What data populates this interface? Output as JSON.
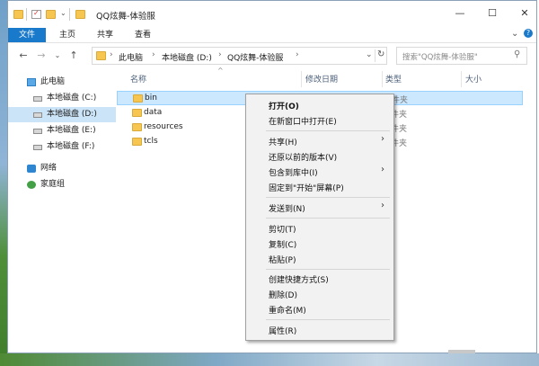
{
  "window": {
    "title": "QQ炫舞-体验服",
    "controls": {
      "minimize": "—",
      "maximize": "☐",
      "close": "✕"
    }
  },
  "ribbon": {
    "tabs": [
      "文件",
      "主页",
      "共享",
      "查看"
    ],
    "expand": "⌄",
    "help": "?"
  },
  "address": {
    "back": "←",
    "forward": "→",
    "recent": "⌄",
    "up": "↑",
    "crumbs": [
      "此电脑",
      "本地磁盘 (D:)",
      "QQ炫舞-体验服"
    ],
    "separator": "›",
    "dropdown": "⌄",
    "refresh": "↻",
    "search_placeholder": "搜索\"QQ炫舞-体验服\"",
    "search_icon": "⚲"
  },
  "navpane": {
    "items": [
      {
        "label": "此电脑",
        "icon": "computer-icon"
      },
      {
        "label": "本地磁盘 (C:)",
        "icon": "drive-icon"
      },
      {
        "label": "本地磁盘 (D:)",
        "icon": "drive-icon",
        "selected": true
      },
      {
        "label": "本地磁盘 (E:)",
        "icon": "drive-icon"
      },
      {
        "label": "本地磁盘 (F:)",
        "icon": "drive-icon"
      },
      {
        "label": "网络",
        "icon": "network-icon"
      },
      {
        "label": "家庭组",
        "icon": "homegroup-icon"
      }
    ]
  },
  "filelist": {
    "columns": [
      "名称",
      "修改日期",
      "类型",
      "大小"
    ],
    "sort_indicator": "^",
    "rows": [
      {
        "name": "bin",
        "type": "件夹",
        "selected": true
      },
      {
        "name": "data",
        "type": "件夹"
      },
      {
        "name": "resources",
        "type": "件夹"
      },
      {
        "name": "tcls",
        "type": "件夹"
      }
    ]
  },
  "context_menu": {
    "arrow": "›",
    "items": [
      {
        "label": "打开(O)",
        "bold": true
      },
      {
        "label": "在新窗口中打开(E)"
      },
      {
        "label": "共享(H)",
        "submenu": true
      },
      {
        "label": "还原以前的版本(V)"
      },
      {
        "label": "包含到库中(I)",
        "submenu": true
      },
      {
        "label": "固定到\"开始\"屏幕(P)"
      },
      {
        "label": "发送到(N)",
        "submenu": true
      },
      {
        "label": "剪切(T)"
      },
      {
        "label": "复制(C)"
      },
      {
        "label": "粘贴(P)"
      },
      {
        "label": "创建快捷方式(S)"
      },
      {
        "label": "删除(D)"
      },
      {
        "label": "重命名(M)"
      },
      {
        "label": "属性(R)"
      }
    ]
  },
  "colors": {
    "accent": "#1979ca",
    "selection": "#cce8ff",
    "folder": "#f6c650"
  }
}
